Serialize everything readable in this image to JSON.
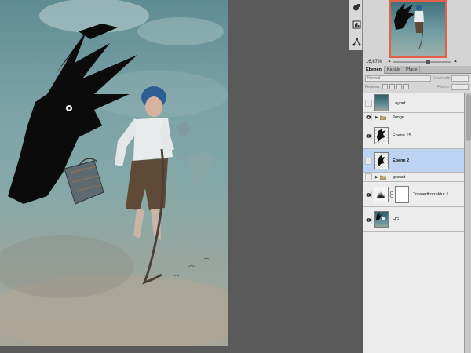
{
  "navigator": {
    "zoom": "16,67%",
    "zoom_level_fraction": 0.6
  },
  "layers_panel": {
    "tabs": [
      {
        "label": "Ebenen",
        "active": true
      },
      {
        "label": "Kanäle",
        "active": false
      },
      {
        "label": "Pfade",
        "active": false
      }
    ],
    "blend_mode": "Normal",
    "opacity_label": "Deckkraft:",
    "lock_label": "Fixieren:",
    "fill_label": "Fläche:",
    "layers": [
      {
        "name": "Layout",
        "type": "layer",
        "visible": false,
        "selected": false,
        "thumb": "art"
      },
      {
        "name": "Junge",
        "type": "group",
        "visible": true,
        "selected": false
      },
      {
        "name": "Ebene 15",
        "type": "layer",
        "visible": true,
        "selected": false,
        "thumb": "transparent"
      },
      {
        "name": "Ebene 2",
        "type": "layer",
        "visible": false,
        "selected": true,
        "thumb": "transparent"
      },
      {
        "name": "gezast",
        "type": "group",
        "visible": false,
        "selected": false
      },
      {
        "name": "Tonwertkorrektur 1",
        "type": "adjustment",
        "visible": true,
        "selected": false
      },
      {
        "name": "HG",
        "type": "layer",
        "visible": true,
        "selected": false,
        "thumb": "art"
      }
    ]
  },
  "colors": {
    "workspace": "#5a5a5a",
    "panel": "#d6d6d6",
    "selected_row": "#bcd3f2",
    "navigator_frame": "#e0604a"
  }
}
